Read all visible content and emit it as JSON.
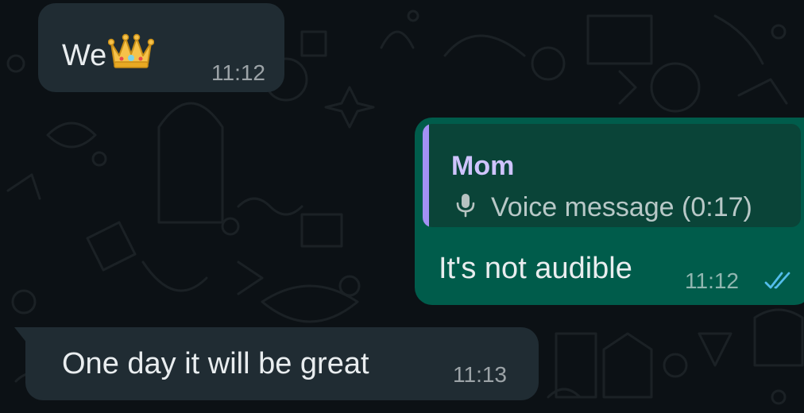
{
  "messages": [
    {
      "direction": "incoming",
      "text": "We",
      "emoji": "👑",
      "time": "11:12"
    },
    {
      "direction": "outgoing",
      "quote": {
        "author": "Mom",
        "preview": "Voice message (0:17)",
        "icon": "microphone-icon"
      },
      "text": "It's not audible",
      "time": "11:12",
      "status": "read",
      "status_icon": "double-check-icon"
    },
    {
      "direction": "incoming",
      "text": "One day it will be great",
      "time": "11:13"
    }
  ],
  "colors": {
    "background": "#0c1115",
    "incoming_bubble": "#202c33",
    "outgoing_bubble": "#005c4b",
    "quote_bar": "#a391f4",
    "read_ticks": "#53bdeb"
  }
}
